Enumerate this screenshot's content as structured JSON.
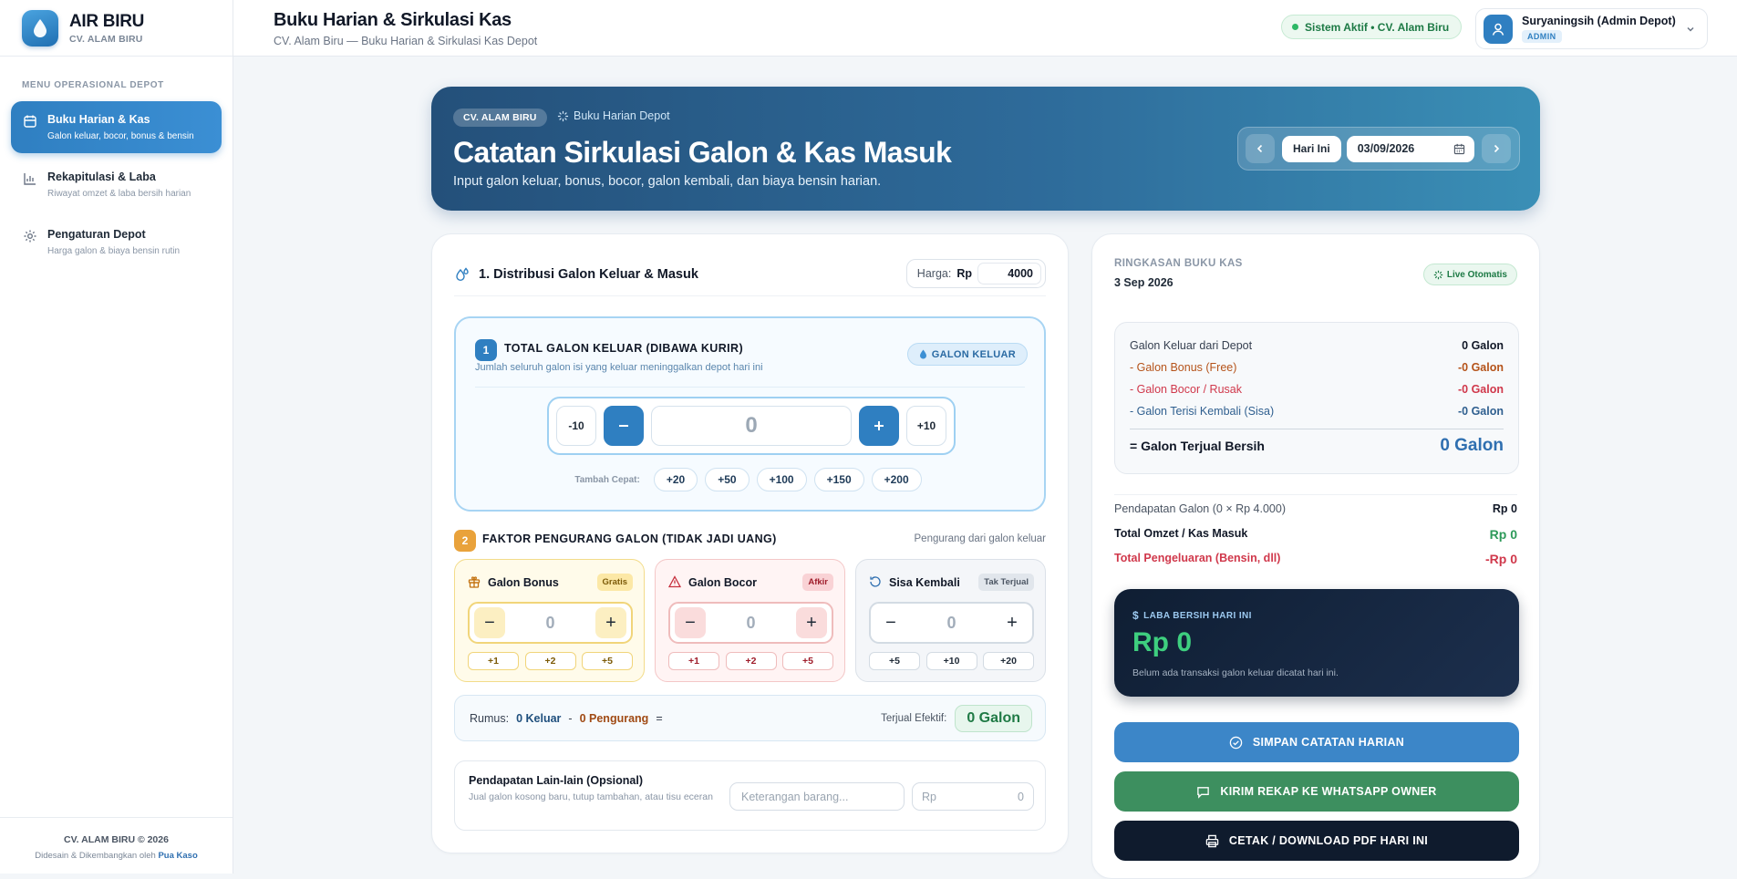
{
  "brand": {
    "name": "AIR BIRU",
    "sub": "CV. ALAM BIRU"
  },
  "sidebar": {
    "menu_title": "MENU OPERASIONAL DEPOT",
    "items": [
      {
        "label": "Buku Harian & Kas",
        "desc": "Galon keluar, bocor, bonus & bensin",
        "icon": "calendar-icon",
        "active": true
      },
      {
        "label": "Rekapitulasi & Laba",
        "desc": "Riwayat omzet & laba bersih harian",
        "icon": "bar-chart-icon",
        "active": false
      },
      {
        "label": "Pengaturan Depot",
        "desc": "Harga galon & biaya bensin rutin",
        "icon": "gear-icon",
        "active": false
      }
    ],
    "footer": {
      "line1": "CV. ALAM BIRU © 2026",
      "line2": "Didesain & Dikembangkan oleh",
      "author": "Pua Kaso"
    }
  },
  "topbar": {
    "title": "Buku Harian & Sirkulasi Kas",
    "subtitle": "CV. Alam Biru — Buku Harian & Sirkulasi Kas Depot",
    "status": "Sistem Aktif • CV. Alam Biru",
    "user_name": "Suryaningsih (Admin Depot)",
    "user_role": "ADMIN"
  },
  "hero": {
    "badge": "CV. ALAM BIRU",
    "tag": "Buku Harian Depot",
    "title": "Catatan Sirkulasi Galon & Kas Masuk",
    "desc": "Input galon keluar, bonus, bocor, galon kembali, dan biaya bensin harian.",
    "today_label": "Hari Ini",
    "date_value": "03/09/2026"
  },
  "distribusi": {
    "title": "1. Distribusi Galon Keluar & Masuk",
    "price_label": "Harga:",
    "price_currency": "Rp",
    "price_value": "4000",
    "step1": {
      "num": "1",
      "title": "TOTAL GALON KELUAR (DIBAWA KURIR)",
      "desc": "Jumlah seluruh galon isi yang keluar meninggalkan depot hari ini",
      "badge": "GALON KELUAR",
      "minus10": "-10",
      "plus10": "+10",
      "value": "0",
      "quick_label": "Tambah Cepat:",
      "quick": [
        "+20",
        "+50",
        "+100",
        "+150",
        "+200"
      ]
    },
    "step2": {
      "num": "2",
      "title": "FAKTOR PENGURANG GALON (TIDAK JADI UANG)",
      "note": "Pengurang dari galon keluar",
      "factors": [
        {
          "title": "Galon Bonus",
          "tag": "Gratis",
          "value": "0",
          "quick": [
            "+1",
            "+2",
            "+5"
          ]
        },
        {
          "title": "Galon Bocor",
          "tag": "Afkir",
          "value": "0",
          "quick": [
            "+1",
            "+2",
            "+5"
          ]
        },
        {
          "title": "Sisa Kembali",
          "tag": "Tak Terjual",
          "value": "0",
          "quick": [
            "+5",
            "+10",
            "+20"
          ]
        }
      ]
    },
    "rumus": {
      "label": "Rumus:",
      "keluar": "0 Keluar",
      "minus": "-",
      "pengurang": "0 Pengurang",
      "eq": "=",
      "eff_label": "Terjual Efektif:",
      "eff_value": "0 Galon"
    },
    "other": {
      "title": "Pendapatan Lain-lain (Opsional)",
      "desc": "Jual galon kosong baru, tutup tambahan, atau tisu eceran",
      "ket_placeholder": "Keterangan barang...",
      "rp_label": "Rp",
      "rp_value": "0"
    }
  },
  "ringkasan": {
    "label": "RINGKASAN BUKU KAS",
    "date": "3 Sep 2026",
    "live": "Live Otomatis",
    "rows": [
      {
        "label": "Galon Keluar dari Depot",
        "value": "0 Galon"
      },
      {
        "label": "- Galon Bonus (Free)",
        "value": "-0 Galon"
      },
      {
        "label": "- Galon Bocor / Rusak",
        "value": "-0 Galon"
      },
      {
        "label": "- Galon Terisi Kembali (Sisa)",
        "value": "-0 Galon"
      }
    ],
    "net_label": "= Galon Terjual Bersih",
    "net_value": "0 Galon",
    "pendapatan_label": "Pendapatan Galon (0 × Rp 4.000)",
    "pendapatan_value": "Rp 0",
    "omzet_label": "Total Omzet / Kas Masuk",
    "omzet_value": "Rp 0",
    "pengeluaran_label": "Total Pengeluaran (Bensin, dll)",
    "pengeluaran_value": "-Rp 0",
    "laba_label": "LABA BERSIH HARI INI",
    "laba_value": "Rp 0",
    "laba_note": "Belum ada transaksi galon keluar dicatat hari ini.",
    "btn_simpan": "SIMPAN CATATAN HARIAN",
    "btn_wa": "KIRIM REKAP KE WHATSAPP OWNER",
    "btn_pdf": "CETAK / DOWNLOAD PDF HARI INI"
  },
  "colors": {
    "primary": "#2f7fc1",
    "success": "#3d8f5f",
    "dark": "#0f1b2d",
    "danger": "#d0384b",
    "warning": "#b5531a"
  }
}
